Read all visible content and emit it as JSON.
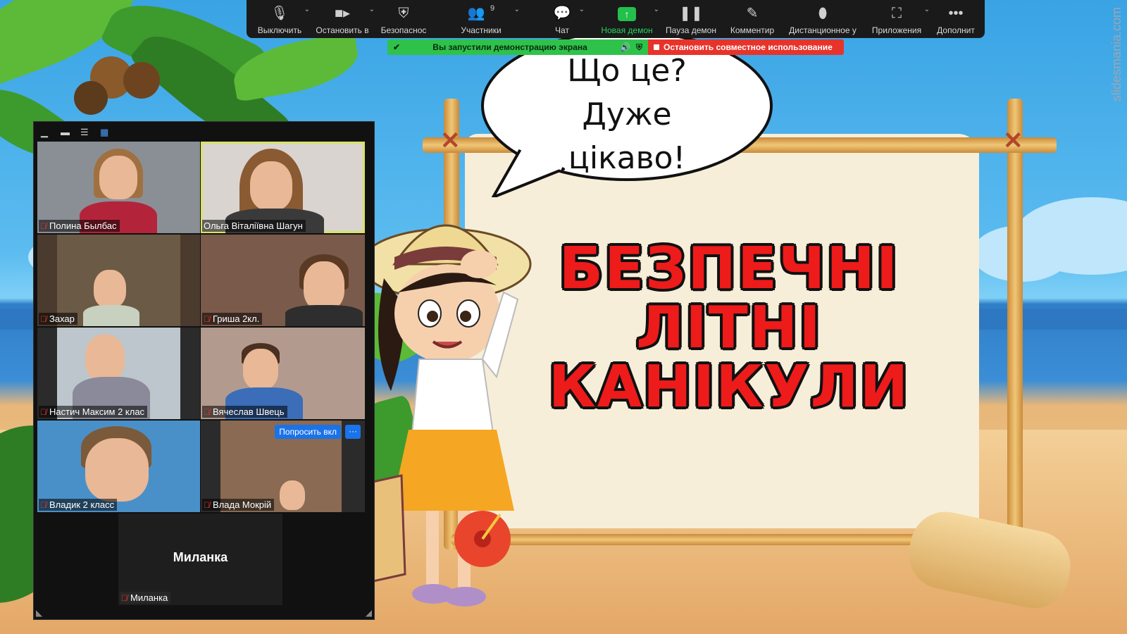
{
  "toolbar": {
    "buttons": [
      {
        "label": "Выключить",
        "icon": "microphone-icon"
      },
      {
        "label": "Остановить в",
        "icon": "video-camera-icon"
      },
      {
        "label": "Безопаснос",
        "icon": "shield-icon"
      },
      {
        "label": "Участники",
        "icon": "participants-icon",
        "count": "9"
      },
      {
        "label": "Чат",
        "icon": "chat-icon"
      },
      {
        "label": "Новая демон",
        "icon": "share-screen-icon"
      },
      {
        "label": "Пауза демон",
        "icon": "pause-icon"
      },
      {
        "label": "Комментир",
        "icon": "pencil-icon"
      },
      {
        "label": "Дистанционное у",
        "icon": "mouse-icon"
      },
      {
        "label": "Приложения",
        "icon": "apps-icon"
      },
      {
        "label": "Дополнит",
        "icon": "more-icon"
      }
    ]
  },
  "share_bar": {
    "status": "Вы запустили демонстрацию экрана",
    "stop_label": "Остановить совместное использование",
    "accent_green": "#2fc24a",
    "accent_red": "#e8332b"
  },
  "gallery": {
    "participants": [
      {
        "name": "Полина Былбас"
      },
      {
        "name": "Ольга Віталіївна Шагун",
        "active": true
      },
      {
        "name": "Захар"
      },
      {
        "name": "Гриша 2кл."
      },
      {
        "name": "Настич Максим 2 клас"
      },
      {
        "name": "Вячеслав Швець"
      },
      {
        "name": "Владик 2 класс"
      },
      {
        "name": "Влада Мокрій"
      },
      {
        "name": "Миланка"
      }
    ],
    "ask_button": "Попросить вкл",
    "more_button": "···",
    "no_video_name": "Миланка"
  },
  "slide": {
    "bubble": [
      "Що це?",
      "Дуже",
      "цікаво!"
    ],
    "title": [
      "БЕЗПЕЧНІ",
      "ЛІТНІ",
      "КАНІКУЛИ"
    ],
    "watermark": "slidesmania.com"
  }
}
